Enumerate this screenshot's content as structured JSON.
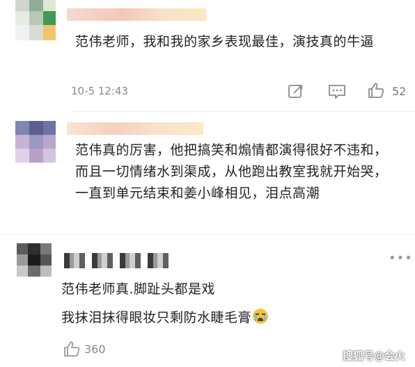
{
  "comments": [
    {
      "text": "范伟老师，我和我的家乡表现最佳，演技真的牛逼",
      "time": "10-5 12:43",
      "likes": "52"
    },
    {
      "text": "范伟真的厉害，他把搞笑和煽情都演得很好不违和，而且一切情绪水到渠成，从他跑出教室我就开始哭，一直到单元结束和姜小峰相见，泪点高潮"
    },
    {
      "line1": "范伟老师真.脚趾头都是戏",
      "line2": "我抹泪抹得眼妆只剩防水睫毛膏",
      "likes": "360",
      "more": "•••"
    }
  ],
  "watermark": "搜狐号@会火",
  "icons": [
    "share-icon",
    "comment-icon",
    "like-icon",
    "more-icon",
    "crying-emoji"
  ],
  "colors": {
    "text": "#222222",
    "meta": "#8a8a8a",
    "divider": "#ececec"
  }
}
